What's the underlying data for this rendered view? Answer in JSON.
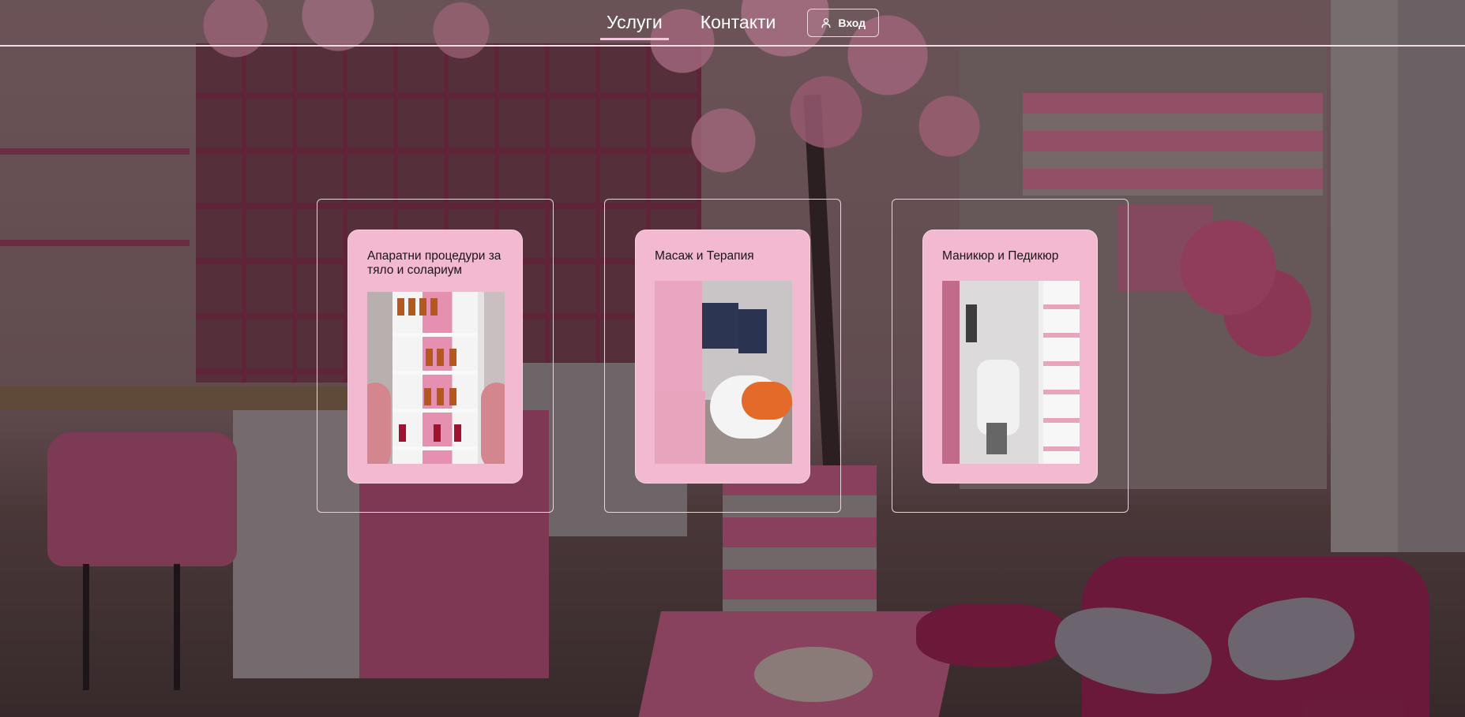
{
  "nav": {
    "services": "Услуги",
    "contacts": "Контакти",
    "login": "Вход"
  },
  "services": [
    {
      "title": "Апаратни процедури за тяло и солариум"
    },
    {
      "title": "Масаж и Терапия"
    },
    {
      "title": "Маникюр и Педикюр"
    }
  ],
  "colors": {
    "card": "#f2b9d1",
    "border": "#f2dce6",
    "accent": "#f4c7da"
  },
  "icons": {
    "login": "user-icon"
  }
}
